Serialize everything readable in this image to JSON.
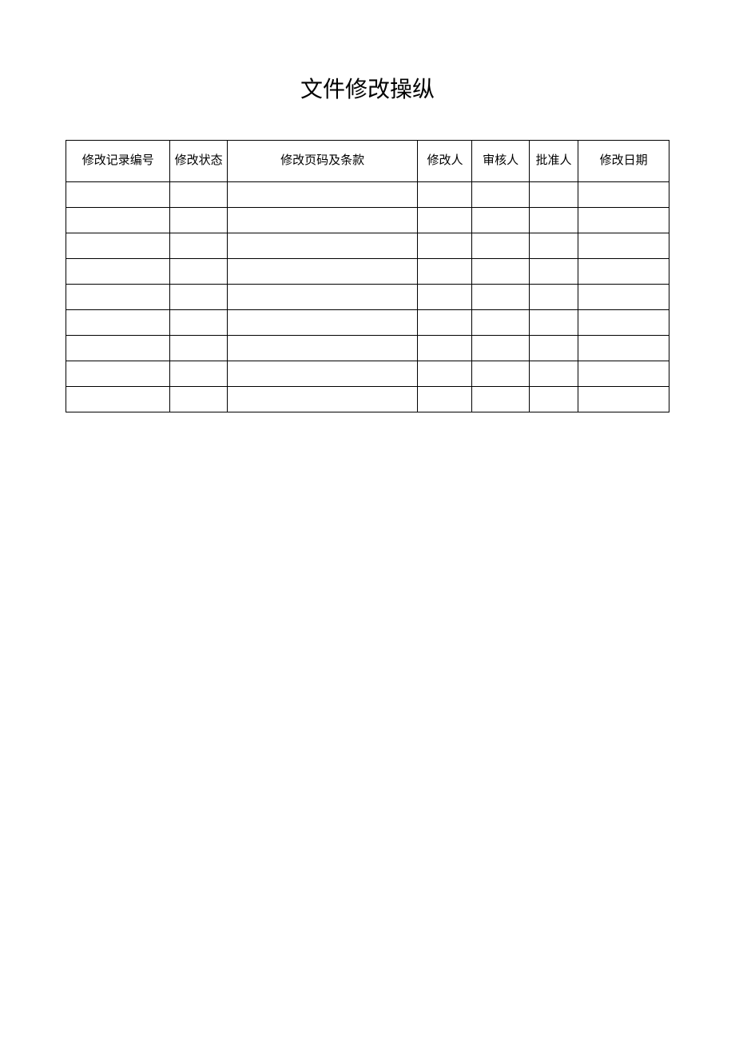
{
  "title": "文件修改操纵",
  "table": {
    "headers": [
      "修改记录编号",
      "修改状态",
      "修改页码及条款",
      "修改人",
      "审核人",
      "批准人",
      "修改日期"
    ],
    "rows": [
      [
        "",
        "",
        "",
        "",
        "",
        "",
        ""
      ],
      [
        "",
        "",
        "",
        "",
        "",
        "",
        ""
      ],
      [
        "",
        "",
        "",
        "",
        "",
        "",
        ""
      ],
      [
        "",
        "",
        "",
        "",
        "",
        "",
        ""
      ],
      [
        "",
        "",
        "",
        "",
        "",
        "",
        ""
      ],
      [
        "",
        "",
        "",
        "",
        "",
        "",
        ""
      ],
      [
        "",
        "",
        "",
        "",
        "",
        "",
        ""
      ],
      [
        "",
        "",
        "",
        "",
        "",
        "",
        ""
      ],
      [
        "",
        "",
        "",
        "",
        "",
        "",
        ""
      ]
    ]
  }
}
